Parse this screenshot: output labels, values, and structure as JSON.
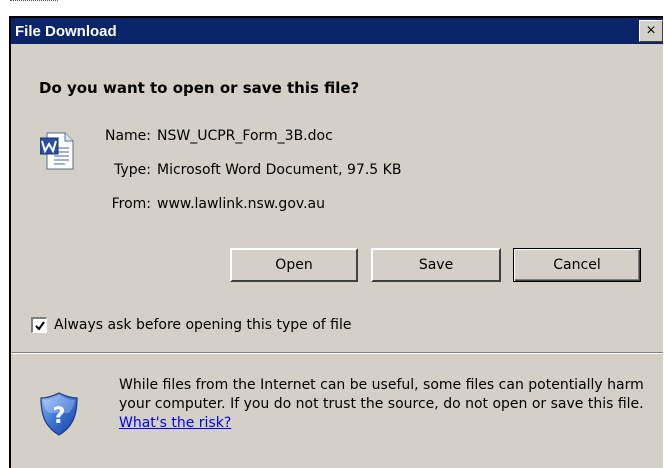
{
  "window": {
    "title": "File Download",
    "close_label": "×"
  },
  "dialog": {
    "question": "Do you want to open or save this file?",
    "file_icon": "word-document-icon",
    "name_label": "Name:",
    "name_value": "NSW_UCPR_Form_3B.doc",
    "type_label": "Type:",
    "type_value": "Microsoft Word Document, 97.5 KB",
    "from_label": "From:",
    "from_value": "www.lawlink.nsw.gov.au"
  },
  "buttons": {
    "open": "Open",
    "save": "Save",
    "cancel": "Cancel"
  },
  "checkbox": {
    "label": "Always ask before opening this type of file",
    "checked": true
  },
  "warning": {
    "icon": "security-shield-icon",
    "text": "While files from the Internet can be useful, some files can potentially harm your computer. If you do not trust the source, do not open or save this file. ",
    "link": "What's the risk?"
  },
  "colors": {
    "titlebar": "#0a246a",
    "dialog_bg": "#d4d0c8",
    "link": "#0000ee"
  }
}
